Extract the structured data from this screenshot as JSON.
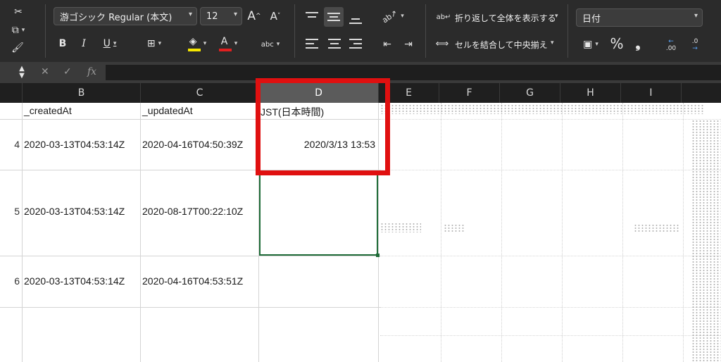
{
  "ribbon": {
    "font_name": "游ゴシック Regular (本文)",
    "font_size": "12",
    "grow_font_icon": "A^",
    "shrink_font_icon": "A˅",
    "bold": "B",
    "italic": "I",
    "underline": "U",
    "font_color_letter": "A",
    "phonetic_label": "abc",
    "wrap_text": "折り返して全体を表示する",
    "merge_center": "セルを結合して中央揃え",
    "number_format": "日付",
    "percent": "%",
    "comma": "❟",
    "inc_decimal": ".00",
    "dec_decimal": ".0"
  },
  "formula_bar": {
    "fx": "fx"
  },
  "columns": [
    {
      "label": "B"
    },
    {
      "label": "C"
    },
    {
      "label": "D"
    },
    {
      "label": "E"
    },
    {
      "label": "F"
    },
    {
      "label": "G"
    },
    {
      "label": "H"
    },
    {
      "label": "I"
    }
  ],
  "header_row": {
    "b": "_createdAt",
    "c": "_updatedAt",
    "d": "JST(日本時間)"
  },
  "rows": [
    {
      "num": "4",
      "b": "2020-03-13T04:53:14Z",
      "c": "2020-04-16T04:50:39Z",
      "d": "2020/3/13 13:53"
    },
    {
      "num": "5",
      "b": "2020-03-13T04:53:14Z",
      "c": "2020-08-17T00:22:10Z",
      "d": ""
    },
    {
      "num": "6",
      "b": "2020-03-13T04:53:14Z",
      "c": "2020-04-16T04:53:51Z",
      "d": ""
    }
  ],
  "colors": {
    "highlight": "#e01010",
    "selection": "#1e6b37",
    "ribbon_bg": "#2b2b2b"
  }
}
